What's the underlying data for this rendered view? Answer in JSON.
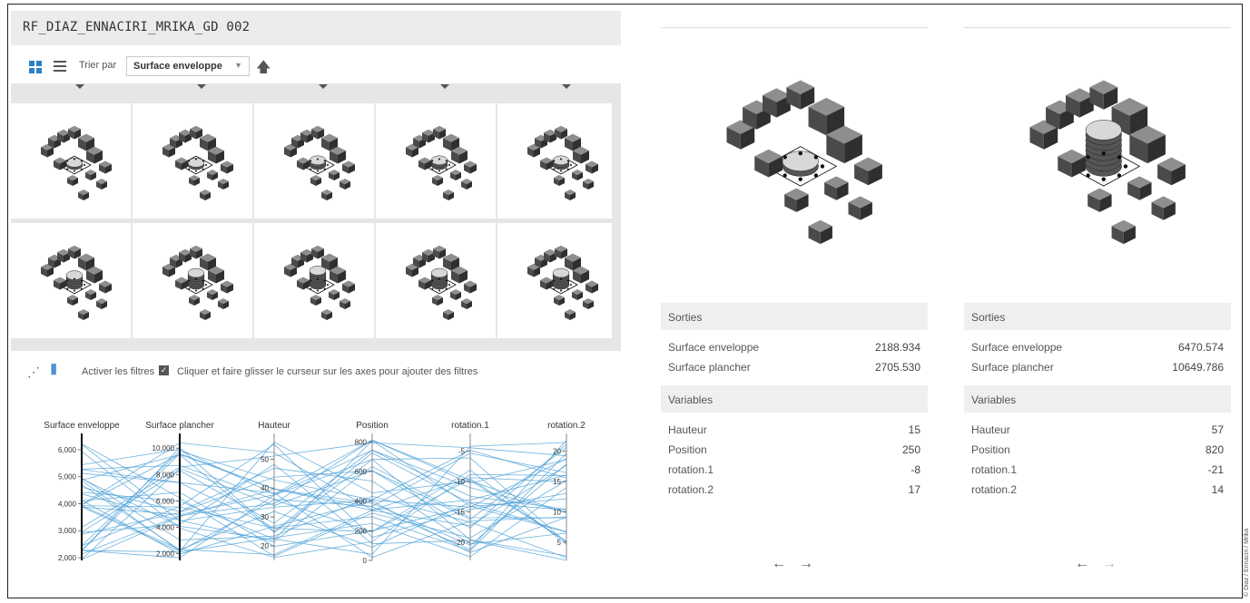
{
  "title": "RF_DIAZ_ENNACIRI_MRIKA_GD 002",
  "toolbar": {
    "grid_icon": "grid-view-icon",
    "list_icon": "list-view-icon",
    "sort_label": "Trier par",
    "sort_value": "Surface enveloppe",
    "sort_direction_icon": "arrow-up-icon"
  },
  "filters": {
    "scatter_icon": "scatter-plot-icon",
    "parallel_icon": "parallel-coordinates-icon",
    "activate_label": "Activer les filtres",
    "hint": "Cliquer et faire glisser le curseur sur les axes pour ajouter des filtres"
  },
  "chart_data": {
    "type": "parallel-coordinates",
    "axes": [
      {
        "name": "Surface enveloppe",
        "ticks": [
          "2,000",
          "3,000",
          "4,000",
          "5,000",
          "6,000"
        ],
        "range": [
          1900,
          6400
        ]
      },
      {
        "name": "Surface plancher",
        "ticks": [
          "2,000",
          "4,000",
          "6,000",
          "8,000",
          "10,000"
        ],
        "range": [
          1500,
          10700
        ]
      },
      {
        "name": "Hauteur",
        "ticks": [
          "20",
          "30",
          "40",
          "50"
        ],
        "range": [
          15,
          57
        ]
      },
      {
        "name": "Position",
        "ticks": [
          "0",
          "200",
          "400",
          "600",
          "800"
        ],
        "range": [
          0,
          820
        ]
      },
      {
        "name": "rotation.1",
        "ticks": [
          "-20",
          "-15",
          "-10",
          "-5"
        ],
        "range": [
          -23,
          -3
        ]
      },
      {
        "name": "rotation.2",
        "ticks": [
          "5",
          "10",
          "15",
          "20"
        ],
        "range": [
          2,
          22
        ]
      }
    ]
  },
  "cards": [
    {
      "sorties_label": "Sorties",
      "outputs": [
        {
          "key": "Surface enveloppe",
          "value": "2188.934"
        },
        {
          "key": "Surface plancher",
          "value": "2705.530"
        }
      ],
      "variables_label": "Variables",
      "variables": [
        {
          "key": "Hauteur",
          "value": "15"
        },
        {
          "key": "Position",
          "value": "250"
        },
        {
          "key": "rotation.1",
          "value": "-8"
        },
        {
          "key": "rotation.2",
          "value": "17"
        }
      ],
      "nav": {
        "prev": "←",
        "next": "→"
      },
      "tower_levels": 2
    },
    {
      "sorties_label": "Sorties",
      "outputs": [
        {
          "key": "Surface enveloppe",
          "value": "6470.574"
        },
        {
          "key": "Surface plancher",
          "value": "10649.786"
        }
      ],
      "variables_label": "Variables",
      "variables": [
        {
          "key": "Hauteur",
          "value": "57"
        },
        {
          "key": "Position",
          "value": "820"
        },
        {
          "key": "rotation.1",
          "value": "-21"
        },
        {
          "key": "rotation.2",
          "value": "14"
        }
      ],
      "nav": {
        "prev": "←",
        "next": "→"
      },
      "tower_levels": 8
    }
  ],
  "thumbnails": [
    {
      "tower_levels": 2
    },
    {
      "tower_levels": 2
    },
    {
      "tower_levels": 3
    },
    {
      "tower_levels": 3
    },
    {
      "tower_levels": 3
    },
    {
      "tower_levels": 5
    },
    {
      "tower_levels": 6
    },
    {
      "tower_levels": 7
    },
    {
      "tower_levels": 6
    },
    {
      "tower_levels": 6
    }
  ],
  "colors": {
    "accent": "#2f7fc7",
    "line": "#4a9fd6",
    "block": "#6b6b6b"
  },
  "credit": "© Diaz / Ennaciri / Mrika"
}
